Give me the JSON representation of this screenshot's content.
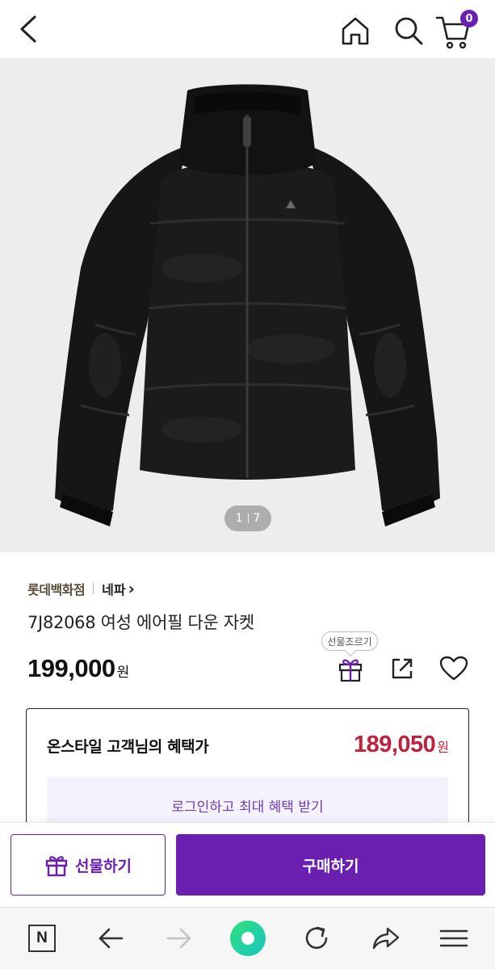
{
  "header": {
    "back_icon": "chevron-left-icon",
    "home_icon": "home-icon",
    "search_icon": "search-icon",
    "cart_icon": "cart-icon",
    "cart_count": "0",
    "badge_color": "#6b1fb1"
  },
  "gallery": {
    "current": "1",
    "total": "7",
    "background": "#ededed"
  },
  "product": {
    "store": "롯데백화점",
    "brand": "네파",
    "brand_chevron": "›",
    "name": "7J82068 여성 에어필 다운 자켓",
    "price": "199,000",
    "price_unit": "원",
    "gift_tooltip": "선물조르기"
  },
  "benefit": {
    "label": "온스타일 고객님의 혜택가",
    "price": "189,050",
    "price_unit": "원",
    "price_color": "#c0213f",
    "login_button": "로그인하고 최대 혜택 받기"
  },
  "actions": {
    "gift_button": "선물하기",
    "buy_button": "구매하기",
    "accent": "#6b1fb1"
  },
  "browser_toolbar": {
    "n_label": "N",
    "icons": [
      "n-home-icon",
      "back-arrow-icon",
      "forward-arrow-icon",
      "green-dot-icon",
      "reload-icon",
      "share-arrow-icon",
      "menu-icon"
    ]
  }
}
